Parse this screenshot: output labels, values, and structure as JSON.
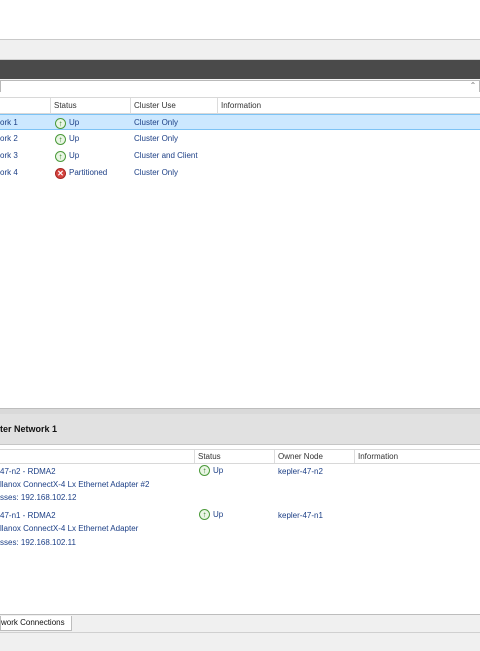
{
  "upper": {
    "columns": [
      "Status",
      "Cluster Use",
      "Information"
    ],
    "rows": [
      {
        "name": "ork 1",
        "status": "Up",
        "status_icon": "up-arrow-icon",
        "cluster_use": "Cluster Only",
        "information": ""
      },
      {
        "name": "ork 2",
        "status": "Up",
        "status_icon": "up-arrow-icon",
        "cluster_use": "Cluster Only",
        "information": ""
      },
      {
        "name": "ork 3",
        "status": "Up",
        "status_icon": "up-arrow-icon",
        "cluster_use": "Cluster and Client",
        "information": ""
      },
      {
        "name": "ork 4",
        "status": "Partitioned",
        "status_icon": "error-x-icon",
        "cluster_use": "Cluster Only",
        "information": ""
      }
    ]
  },
  "detail": {
    "title": "ter Network 1",
    "columns": [
      "Status",
      "Owner Node",
      "Information"
    ],
    "items": [
      {
        "line1": "47-n2 - RDMA2",
        "line2": "llanox ConnectX-4 Lx Ethernet Adapter #2",
        "line3": "sses: 192.168.102.12",
        "status": "Up",
        "owner": "kepler-47-n2"
      },
      {
        "line1": "47-n1 - RDMA2",
        "line2": "llanox ConnectX-4 Lx Ethernet Adapter",
        "line3": "sses: 192.168.102.11",
        "status": "Up",
        "owner": "kepler-47-n1"
      }
    ]
  },
  "tabs": {
    "network_connections": "work Connections"
  },
  "colors": {
    "selection": "#cce8ff",
    "link_text": "#1c3f86",
    "dark_bar": "#4a4a4a"
  }
}
